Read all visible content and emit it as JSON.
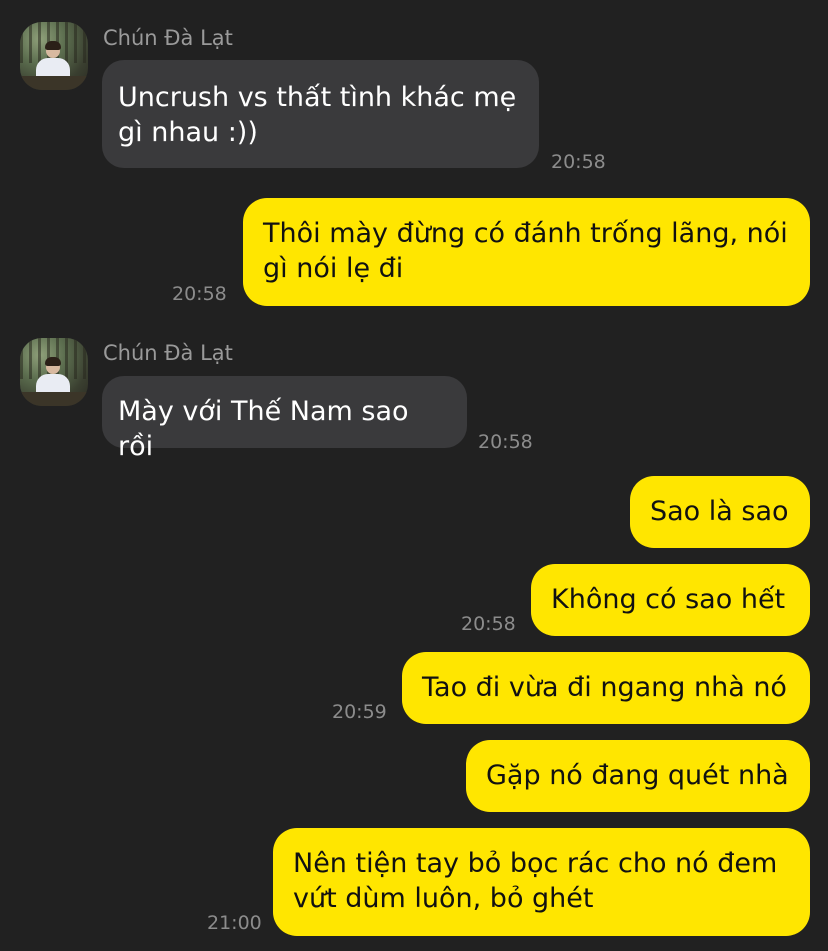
{
  "chat": {
    "contact_name": "Chún Đà Lạt",
    "messages": [
      {
        "side": "in",
        "text": "Uncrush vs thất tình khác mẹ gì nhau :))",
        "time": "20:58"
      },
      {
        "side": "out",
        "text": "Thôi mày đừng có đánh trống lãng, nói gì nói lẹ đi",
        "time": "20:58"
      },
      {
        "side": "in",
        "text": "Mày với Thế Nam sao rồi",
        "time": "20:58"
      },
      {
        "side": "out",
        "text": "Sao là sao",
        "time": ""
      },
      {
        "side": "out",
        "text": "Không có sao hết",
        "time": "20:58"
      },
      {
        "side": "out",
        "text": "Tao đi vừa đi ngang nhà nó",
        "time": "20:59"
      },
      {
        "side": "out",
        "text": "Gặp nó đang quét nhà",
        "time": ""
      },
      {
        "side": "out",
        "text": "Nên tiện tay bỏ bọc rác cho nó đem vứt dùm luôn, bỏ ghét",
        "time": "21:00"
      }
    ]
  },
  "colors": {
    "background": "#212121",
    "incoming_bubble": "#3a3a3c",
    "outgoing_bubble": "#ffe600"
  }
}
